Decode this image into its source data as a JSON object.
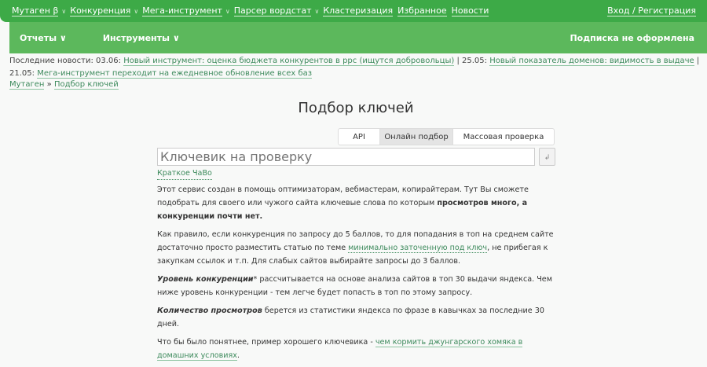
{
  "topnav": {
    "items": [
      {
        "label": "Мутаген β",
        "dropdown": true
      },
      {
        "label": "Конкуренция",
        "dropdown": true
      },
      {
        "label": "Мега-инструмент",
        "dropdown": true
      },
      {
        "label": "Парсер вордстат",
        "dropdown": true
      },
      {
        "label": "Кластеризация",
        "dropdown": false
      },
      {
        "label": "Избранное",
        "dropdown": false
      },
      {
        "label": "Новости",
        "dropdown": false
      }
    ],
    "login": "Вход / Регистрация"
  },
  "subnav": {
    "reports": "Отчеты",
    "tools": "Инструменты",
    "subscription": "Подписка не оформлена"
  },
  "news": {
    "label": "Последние новости:",
    "items": [
      {
        "date": "03.06:",
        "title": "Новый инструмент: оценка бюджета конкурентов в ppc (ищутся добровольцы)"
      },
      {
        "date": "25.05:",
        "title": "Новый показатель доменов: видимость в выдаче"
      },
      {
        "date": "21.05:",
        "title": "Мега-инструмент переходит на ежедневное обновление всех баз"
      }
    ],
    "sep": "|"
  },
  "breadcrumb": {
    "root": "Мутаген",
    "sep": "»",
    "current": "Подбор ключей"
  },
  "title": "Подбор ключей",
  "tabs": [
    {
      "label": "API",
      "active": false
    },
    {
      "label": "Онлайн подбор",
      "active": true
    },
    {
      "label": "Массовая проверка",
      "active": false
    }
  ],
  "search": {
    "placeholder": "Ключевик на проверку",
    "value": "",
    "submit": "↲"
  },
  "content": {
    "faq": "Краткое ЧаВо",
    "p1a": "Этот сервис создан в помощь оптимизаторам, вебмастерам, копирайтерам. Тут Вы сможете подобрать для своего или чужого сайта ключевые слова по которым ",
    "p1b": "просмотров много, а конкуренции почти нет.",
    "p2a": "Как правило, если конкуренция по запросу до 5 баллов, то для попадания в топ на среднем сайте достаточно просто разместить статью по теме ",
    "p2link": "минимально заточенную под ключ",
    "p2b": ", не прибегая к закупкам ссылок и т.п. Для слабых сайтов выбирайте запросы до 3 баллов.",
    "p3b": "Уровень конкуренции",
    "p3a": "* рассчитывается на основе анализа сайтов в топ 30 выдачи яндекса. Чем ниже уровень конкуренции - тем легче будет попасть в топ по этому запросу.",
    "p4b": "Количество просмотров",
    "p4a": " берется из статистики яндекса по фразе в кавычках за последние 30 дней.",
    "p5a": "Что бы было понятнее, пример хорошего ключевика - ",
    "p5link": "чем кормить джунгарского хомяка в домашних условиях",
    "p5b": "."
  },
  "colors": {
    "topbar": "#3daa47",
    "subbar": "#5cb85c",
    "link": "#3d8a5c"
  }
}
